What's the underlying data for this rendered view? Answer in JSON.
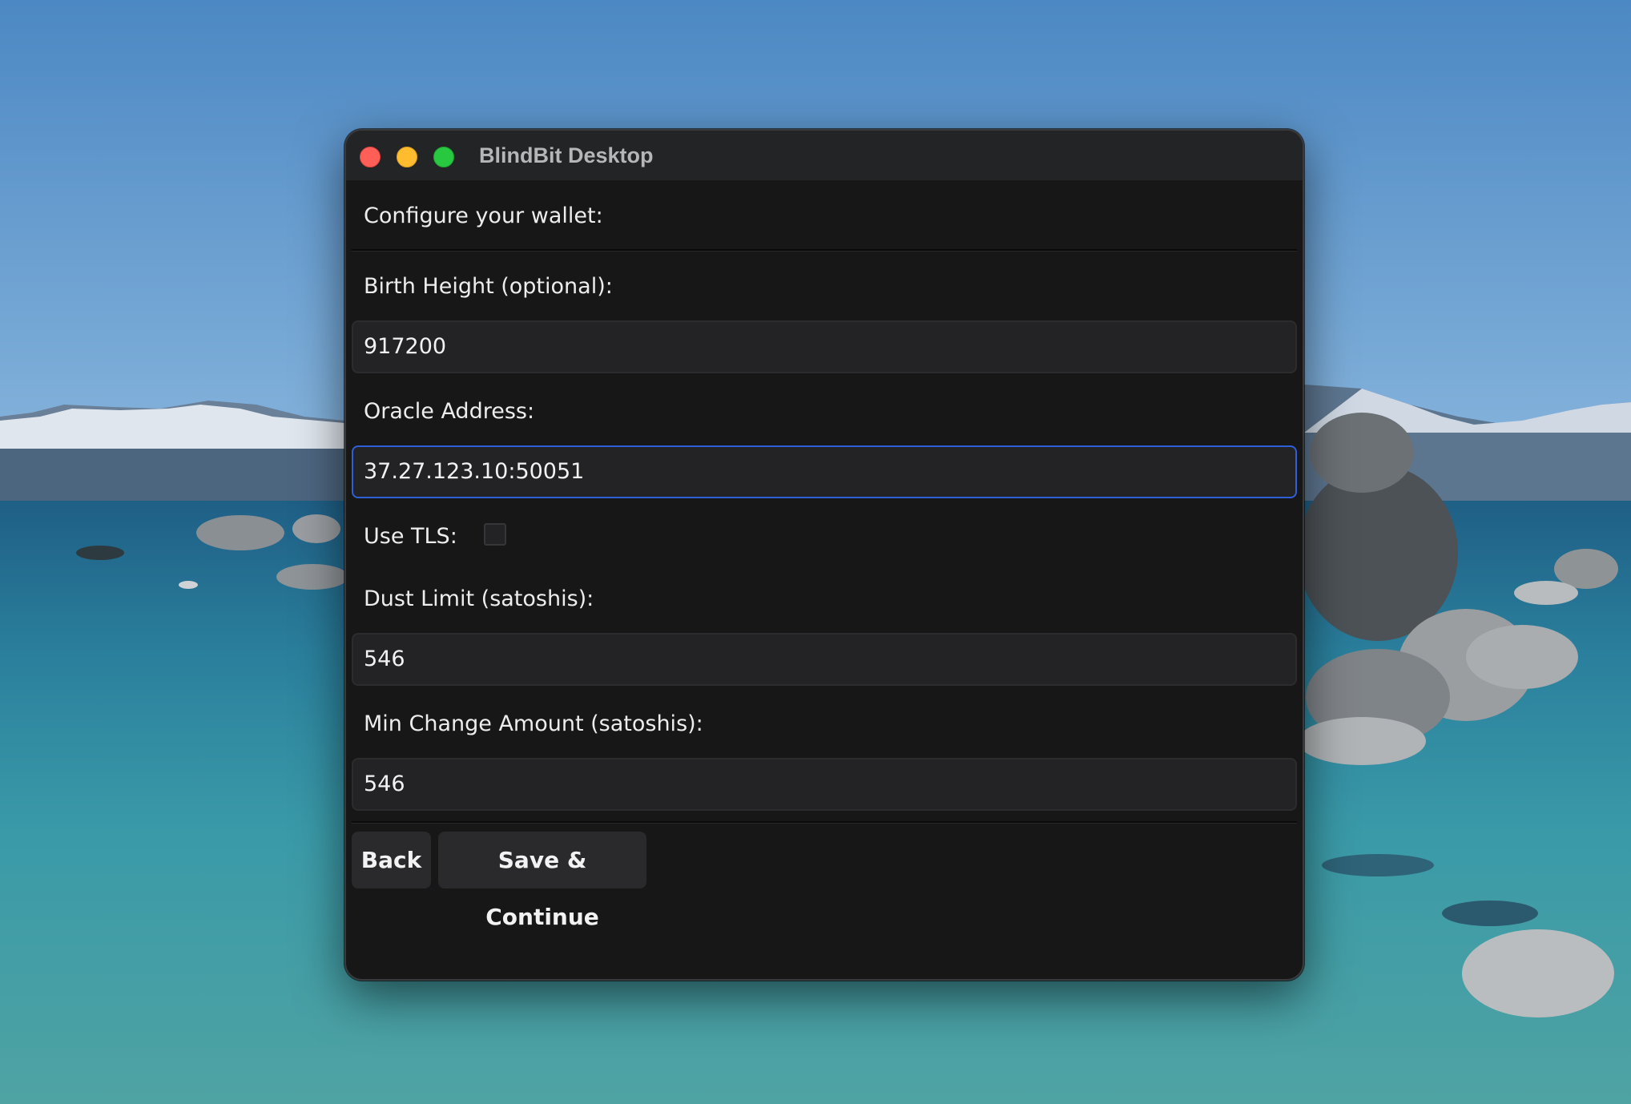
{
  "window": {
    "title": "BlindBit Desktop"
  },
  "form": {
    "heading": "Configure your wallet:",
    "birth_height": {
      "label": "Birth Height (optional):",
      "value": "917200"
    },
    "oracle_address": {
      "label": "Oracle Address:",
      "value": "37.27.123.10:50051",
      "focused": true
    },
    "use_tls": {
      "label": "Use TLS:",
      "checked": false
    },
    "dust_limit": {
      "label": "Dust Limit (satoshis):",
      "value": "546"
    },
    "min_change": {
      "label": "Min Change Amount (satoshis):",
      "value": "546"
    }
  },
  "buttons": {
    "back_label": "Back",
    "save_label": "Save & Continue"
  },
  "colors": {
    "window_bg": "#171718",
    "titlebar_bg": "#232426",
    "field_bg": "#232325",
    "focus_border": "#2f5fd6",
    "button_bg": "#2a2a2c",
    "traffic_close": "#ff5f57",
    "traffic_minimize": "#febc2e",
    "traffic_maximize": "#28c840"
  }
}
